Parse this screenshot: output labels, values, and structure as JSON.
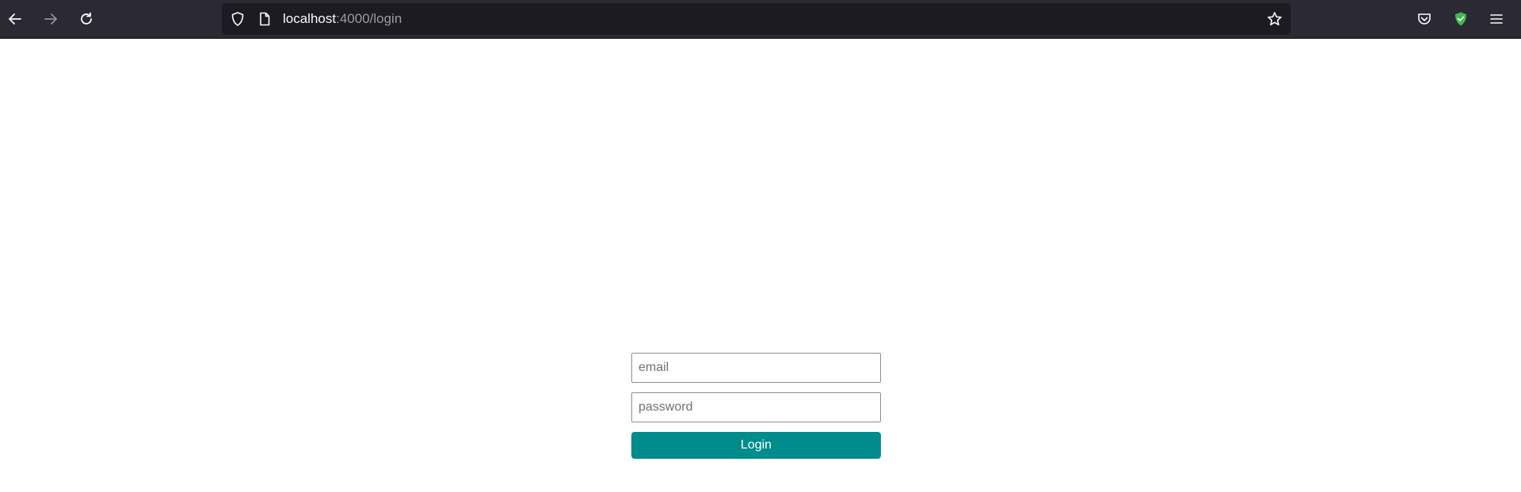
{
  "browser": {
    "url_host": "localhost",
    "url_path": ":4000/login",
    "icons": {
      "back": "back-arrow-icon",
      "forward": "forward-arrow-icon",
      "reload": "reload-icon",
      "tracking": "shield-icon",
      "page": "page-icon",
      "bookmark": "star-icon",
      "pocket": "pocket-icon",
      "extension": "extension-shield-icon",
      "menu": "hamburger-menu-icon"
    },
    "colors": {
      "toolbar": "#2b2a33",
      "urlbar": "#1c1b22",
      "extension_green": "#3fb950"
    }
  },
  "login": {
    "email_placeholder": "email",
    "email_value": "",
    "password_placeholder": "password",
    "password_value": "",
    "submit_label": "Login",
    "accent_color": "#008c8c"
  }
}
